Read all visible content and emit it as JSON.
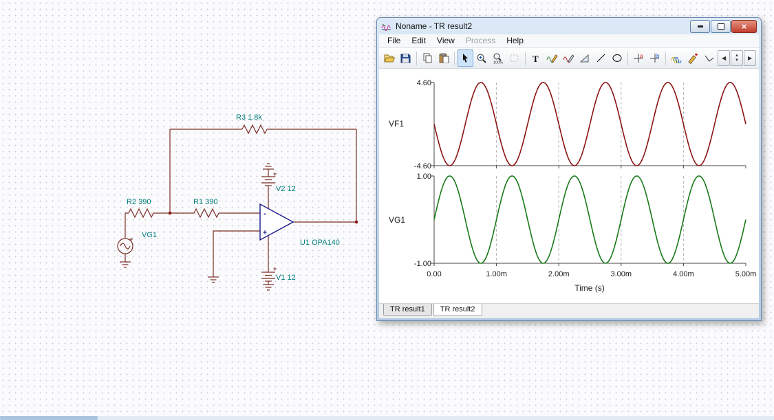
{
  "schematic": {
    "label_color": "#007d7d",
    "wire_color": "#7b2d26",
    "opamp_color": "#16168c",
    "junction_color": "#8c1616",
    "labels": {
      "r3": "R3 1.8k",
      "r2": "R2 390",
      "r1": "R1 390",
      "vg1": "VG1",
      "v2": "V2 12",
      "u1": "U1 OPA140",
      "v1": "V1 12"
    },
    "opamp_minus": "-",
    "opamp_plus": "+",
    "polarity_plus": "+"
  },
  "window": {
    "title": "Noname - TR result2",
    "menu": [
      {
        "label": "File",
        "enabled": true
      },
      {
        "label": "Edit",
        "enabled": true
      },
      {
        "label": "View",
        "enabled": true
      },
      {
        "label": "Process",
        "enabled": false
      },
      {
        "label": "Help",
        "enabled": true
      }
    ],
    "toolbar_icons": [
      "open-file",
      "save",
      "copy",
      "paste",
      "cursor-select",
      "zoom-in",
      "zoom-100",
      "select-region",
      "text-tool",
      "probe-edit",
      "probe-edit-alt",
      "slope-tool",
      "line-tool",
      "ellipse-tool",
      "axis-a",
      "axis-b",
      "curves",
      "pencil-add",
      "corner-line",
      "page-prev",
      "page-spinner",
      "page-next"
    ],
    "nav": {
      "prev": "◀",
      "up": "▲",
      "down": "▼",
      "next": "▶"
    },
    "close_glyph": "×",
    "tabs": [
      {
        "label": "TR result1",
        "active": false
      },
      {
        "label": "TR result2",
        "active": true
      }
    ]
  },
  "chart_data": [
    {
      "type": "line",
      "panel": "top",
      "ylabel": "VF1",
      "ylabel_color": "#1a1a1a",
      "ylim": [
        -4.6,
        4.6
      ],
      "ytick_labels": [
        "4.60",
        "-4.60"
      ],
      "x_range_s": [
        0,
        0.005
      ],
      "grid": "vertical-dashed",
      "series": [
        {
          "name": "VF1",
          "color": "#8c1414",
          "waveform": "sine",
          "amplitude": 4.6,
          "frequency_hz": 1000,
          "phase_deg": 180,
          "offset": 0
        }
      ]
    },
    {
      "type": "line",
      "panel": "bottom",
      "ylabel": "VG1",
      "ylabel_color": "#177a17",
      "ylim": [
        -1.0,
        1.0
      ],
      "ytick_labels": [
        "1.00",
        "-1.00"
      ],
      "x_range_s": [
        0,
        0.005
      ],
      "xtick_labels": [
        "0.00",
        "1.00m",
        "2.00m",
        "3.00m",
        "4.00m",
        "5.00m"
      ],
      "xlabel": "Time (s)",
      "grid": "vertical-dashed",
      "series": [
        {
          "name": "VG1",
          "color": "#177a17",
          "waveform": "sine",
          "amplitude": 1.0,
          "frequency_hz": 1000,
          "phase_deg": 0,
          "offset": 0
        }
      ]
    }
  ]
}
